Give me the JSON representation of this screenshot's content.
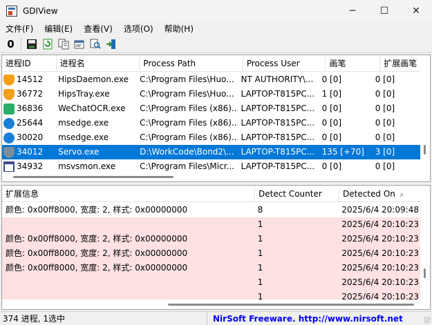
{
  "window": {
    "title": "GDIView",
    "minimize": "─",
    "maximize": "☐",
    "close": "✕"
  },
  "menu": [
    {
      "label": "文件(F)"
    },
    {
      "label": "编辑(E)"
    },
    {
      "label": "查看(V)"
    },
    {
      "label": "选项(O)"
    },
    {
      "label": "帮助(H)"
    }
  ],
  "toolbar": {
    "refresh_label": "0",
    "icons": [
      "save-icon",
      "reload-icon",
      "copy-icon",
      "properties-icon",
      "find-icon",
      "exit-icon"
    ]
  },
  "process_table": {
    "columns": [
      "进程ID",
      "进程名",
      "Process Path",
      "Process User",
      "画笔",
      "扩展画笔"
    ],
    "rows": [
      {
        "pid": "14512",
        "name": "HipsDaemon.exe",
        "path": "C:\\Program Files\\Huo...",
        "user": "NT AUTHORITY\\...",
        "pen": "0  [0]",
        "extpen": "0  [0]",
        "icon": "huorong-shield-icon",
        "icon_color": "#f2a01c",
        "selected": false
      },
      {
        "pid": "36772",
        "name": "HipsTray.exe",
        "path": "C:\\Program Files\\Huo...",
        "user": "LAPTOP-T815PC...",
        "pen": "1  [0]",
        "extpen": "0  [0]",
        "icon": "huorong-shield-icon",
        "icon_color": "#f2a01c",
        "selected": false
      },
      {
        "pid": "36836",
        "name": "WeChatOCR.exe",
        "path": "C:\\Program Files (x86)...",
        "user": "LAPTOP-T815PC...",
        "pen": "0  [0]",
        "extpen": "0  [0]",
        "icon": "wechat-icon",
        "icon_color": "#2aae67",
        "selected": false
      },
      {
        "pid": "25644",
        "name": "msedge.exe",
        "path": "C:\\Program Files (x86)...",
        "user": "LAPTOP-T815PC...",
        "pen": "0  [0]",
        "extpen": "0  [0]",
        "icon": "edge-icon",
        "icon_color": "#1a7fd4",
        "selected": false
      },
      {
        "pid": "30020",
        "name": "msedge.exe",
        "path": "C:\\Program Files (x86)...",
        "user": "LAPTOP-T815PC...",
        "pen": "0  [0]",
        "extpen": "0  [0]",
        "icon": "edge-icon",
        "icon_color": "#1a7fd4",
        "selected": false
      },
      {
        "pid": "34012",
        "name": "Servo.exe",
        "path": "D:\\WorkCode\\Bond2\\...",
        "user": "LAPTOP-T815PC...",
        "pen": "135  [+70]",
        "extpen": "3  [0]",
        "icon": "servo-shield-icon",
        "icon_color": "#7a8c9c",
        "selected": true
      },
      {
        "pid": "34932",
        "name": "msvsmon.exe",
        "path": "C:\\Program Files\\Micr...",
        "user": "LAPTOP-T815PC...",
        "pen": "0  [0]",
        "extpen": "0  [0]",
        "icon": "window-app-icon",
        "icon_color": "#3b4a8a",
        "selected": false
      }
    ]
  },
  "detail_table": {
    "columns": [
      "扩展信息",
      "Detect Counter",
      "Detected On"
    ],
    "rows": [
      {
        "info": "颜色: 0x00ff8000, 宽度: 2, 样式: 0x00000000",
        "counter": "8",
        "detected": "2025/6/4 20:09:48",
        "pink": false
      },
      {
        "info": "",
        "counter": "1",
        "detected": "2025/6/4 20:10:23",
        "pink": true
      },
      {
        "info": "颜色: 0x00ff8000, 宽度: 2, 样式: 0x00000000",
        "counter": "1",
        "detected": "2025/6/4 20:10:23",
        "pink": true
      },
      {
        "info": "颜色: 0x00ff8000, 宽度: 2, 样式: 0x00000000",
        "counter": "1",
        "detected": "2025/6/4 20:10:23",
        "pink": true
      },
      {
        "info": "颜色: 0x00ff8000, 宽度: 2, 样式: 0x00000000",
        "counter": "1",
        "detected": "2025/6/4 20:10:23",
        "pink": true
      },
      {
        "info": "",
        "counter": "1",
        "detected": "2025/6/4 20:10:23",
        "pink": true
      },
      {
        "info": "",
        "counter": "1",
        "detected": "2025/6/4 20:10:23",
        "pink": true
      }
    ]
  },
  "status": {
    "left": "374 进程, 1选中",
    "link": "NirSoft Freeware.  http://www.nirsoft.net"
  },
  "colors": {
    "selection": "#0078d7",
    "highlight_row": "#fde1e3",
    "link": "#0000ee"
  }
}
